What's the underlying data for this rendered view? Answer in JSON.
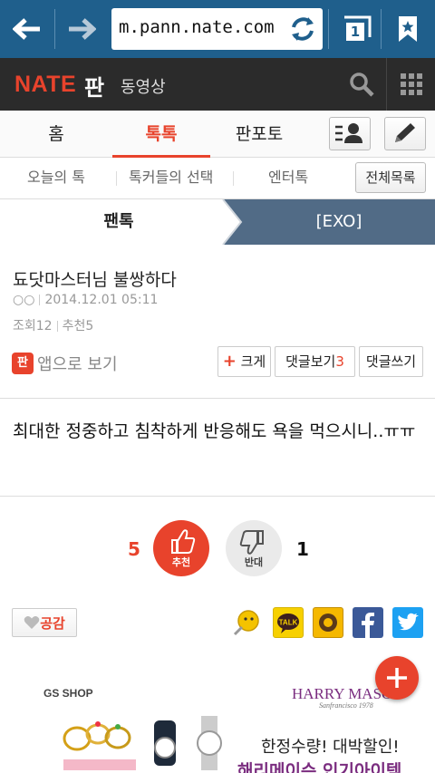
{
  "browser": {
    "url": "m.pann.nate.com",
    "tab_count": "1",
    "icons": [
      "back-arrow-icon",
      "forward-arrow-icon",
      "reload-icon",
      "tabs-icon",
      "bookmark-icon"
    ]
  },
  "header": {
    "logo": "NATE",
    "logo_sub": "판",
    "video_link": "동영상",
    "icons": [
      "search-icon",
      "apps-grid-icon"
    ]
  },
  "tabs": [
    {
      "label": "홈",
      "active": false
    },
    {
      "label": "톡톡",
      "active": true
    },
    {
      "label": "판포토",
      "active": false
    }
  ],
  "submenu": {
    "items": [
      "오늘의 톡",
      "톡커들의 선택",
      "엔터톡"
    ],
    "all_button": "전체목록"
  },
  "category": {
    "left": "팬톡",
    "right": "[EXO]"
  },
  "post": {
    "title": "됴닷마스터님 불쌍하다",
    "author": "○○",
    "date": "2014.12.01 05:11",
    "views_label": "조회",
    "views": "12",
    "recommend_label": "추천",
    "recommend": "5",
    "app_icon": "판",
    "app_view": "앱으로 보기",
    "enlarge": "크게",
    "comments_view": "댓글보기",
    "comment_count": "3",
    "write_comment": "댓글쓰기",
    "body": "최대한 정중하고 침착하게 반응해도 욕을 먹으시니..ㅠㅠ"
  },
  "votes": {
    "up_count": "5",
    "up_label": "추천",
    "down_label": "반대",
    "down_count": "1"
  },
  "share": {
    "like_label": "공감",
    "services": [
      "nate-emoticon-icon",
      "kakaotalk-icon",
      "kakaostory-icon",
      "facebook-icon",
      "twitter-icon"
    ]
  },
  "ad": {
    "brand_left": "GS SHOP",
    "brand_right": "HARRY MASON",
    "brand_right_sub": "Sanfrancisco 1978",
    "line1": "한정수량! 대박할인!",
    "line2": "해리메이슨 인기아이템"
  },
  "colors": {
    "browser_bar": "#1f5f8c",
    "nate_bar": "#2b2b2b",
    "accent": "#e8432c",
    "category_right": "#516b86",
    "facebook": "#3b5998",
    "twitter": "#1da1f2",
    "kakao": "#f7d000"
  }
}
